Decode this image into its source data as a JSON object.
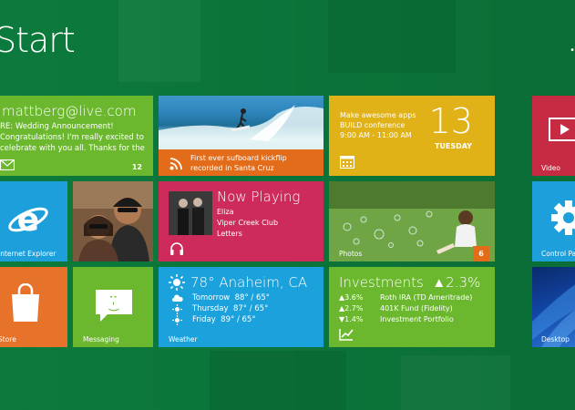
{
  "screen": {
    "title": "Start"
  },
  "tiles": {
    "mail": {
      "address": "mattberg@live.com",
      "lines": [
        "RE: Wedding Announcement!",
        "Congratulations! I'm really excited to",
        "celebrate with you all. Thanks for the ..."
      ],
      "count": "12"
    },
    "news": {
      "caption_line1": "First ever sufboard kickflip",
      "caption_line2": "recorded in Santa Cruz"
    },
    "calendar": {
      "event_line1": "Make awesome apps",
      "event_line2": "BUILD conference",
      "event_line3": "9:00 AM - 11:00 AM",
      "date": "13",
      "weekday": "TUESDAY"
    },
    "video": {
      "label": "Video"
    },
    "internet_explorer": {
      "label": "Internet Explorer"
    },
    "music": {
      "title": "Now Playing",
      "artist": "Eliza",
      "album": "Viper Creek Club",
      "track": "Letters"
    },
    "photos": {
      "label": "Photos",
      "count": "6"
    },
    "control_panel": {
      "label": "Control Panel"
    },
    "store": {
      "label": "Store"
    },
    "messaging": {
      "label": "Messaging"
    },
    "weather": {
      "title": "78° Anaheim, CA",
      "label": "Weather",
      "forecast": [
        {
          "day": "Tomorrow",
          "temps": "88° / 65°"
        },
        {
          "day": "Thursday",
          "temps": "87° / 65°"
        },
        {
          "day": "Friday",
          "temps": "89° / 65°"
        }
      ]
    },
    "investments": {
      "title": "Investments",
      "change": "▲2.3%",
      "rows": [
        {
          "change": "▲3.6%",
          "name": "Roth IRA (TD Ameritrade)"
        },
        {
          "change": "▲2.7%",
          "name": "401K Fund (Fidelity)"
        },
        {
          "change": "▼1.4%",
          "name": "Investment Portfolio"
        }
      ]
    },
    "desktop": {
      "label": "Desktop"
    }
  },
  "icons": {
    "mail": "mail-icon",
    "news": "rss-icon",
    "calendar": "calendar-icon",
    "video": "video-icon",
    "ie": "internet-explorer-icon",
    "music": "headphones-icon",
    "control_panel": "gear-icon",
    "store": "shopping-bag-icon",
    "messaging": "chat-bubble-icon",
    "weather": "sun-icon",
    "investments": "chart-icon"
  },
  "colors": {
    "background": "#0c7a3c",
    "green_tile": "#6bb82e",
    "orange_tile": "#e36c1a",
    "yellow_tile": "#e0b218",
    "red_tile": "#c72b44",
    "blue_tile": "#1d9fdc",
    "magenta_tile": "#cd2b5b"
  }
}
